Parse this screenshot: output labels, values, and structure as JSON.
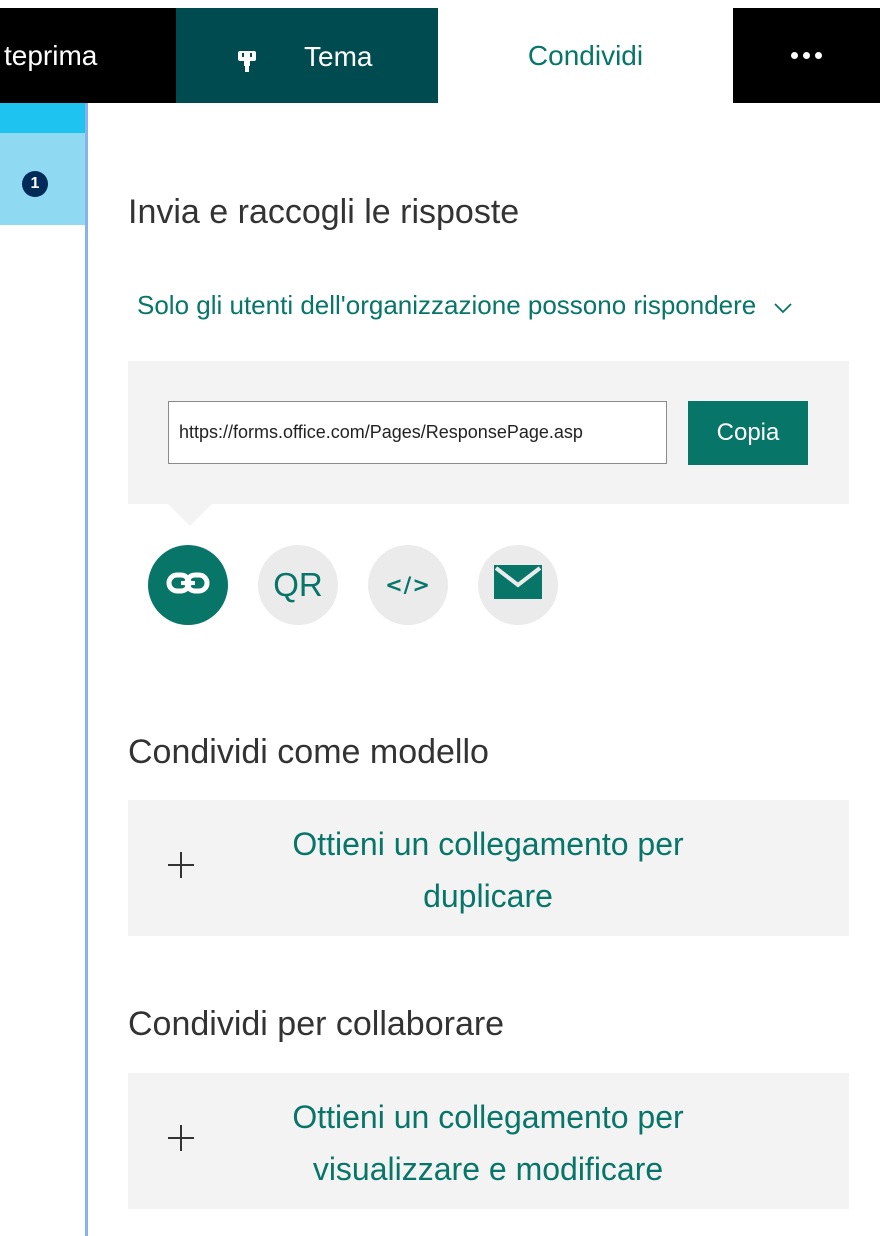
{
  "toolbar": {
    "preview_label": "teprima",
    "theme_label": "Tema",
    "share_label": "Condividi",
    "more_icon": "more-icon"
  },
  "sidebar": {
    "question_number": "1"
  },
  "send": {
    "title": "Invia e raccogli le risposte",
    "audience_label": "Solo gli utenti dell'organizzazione possono rispondere",
    "link_value": "https://forms.office.com/Pages/ResponsePage.asp",
    "copy_label": "Copia",
    "methods": [
      {
        "name": "link",
        "label": "",
        "icon": "link-icon",
        "active": true
      },
      {
        "name": "qr",
        "label": "QR",
        "icon": "qr-icon",
        "active": false
      },
      {
        "name": "embed",
        "label": "</>",
        "icon": "embed-icon",
        "active": false
      },
      {
        "name": "email",
        "label": "",
        "icon": "email-icon",
        "active": false
      }
    ]
  },
  "template": {
    "title": "Condividi come modello",
    "action_label": "Ottieni un collegamento per duplicare"
  },
  "collaborate": {
    "title": "Condividi per collaborare",
    "action_label": "Ottieni un collegamento per visualizzare e modificare"
  },
  "colors": {
    "accent": "#077568",
    "theme_tab": "#004b50",
    "panel_bg": "#f3f3f3"
  }
}
